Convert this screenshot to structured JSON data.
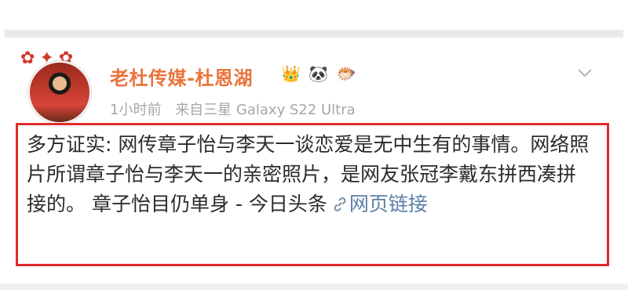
{
  "post": {
    "username": "老杜传媒-杜恩湖",
    "badges": [
      "👑",
      "🐼",
      "🐡"
    ],
    "time": "1小时前",
    "source": "来自三星 Galaxy S22 Ultra",
    "text": "多方证实: 网传章子怡与李天一谈恋爱是无中生有的事情。网络照片所谓章子怡与李天一的亲密照片，是网友张冠李戴东拼西凑拼接的。 章子怡目仍单身 - 今日头条",
    "link_label": "网页链接"
  },
  "colors": {
    "username": "#e8743b",
    "highlight_border": "#e02a2a",
    "link": "#5a7fa6"
  },
  "icons": {
    "chevron": "chevron-down-icon",
    "link": "link-icon"
  }
}
